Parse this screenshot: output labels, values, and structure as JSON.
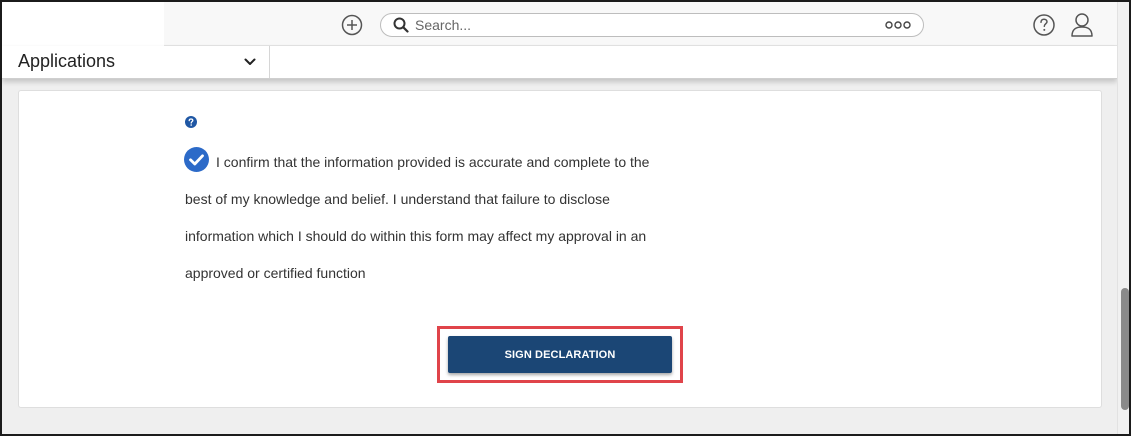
{
  "topbar": {
    "search_placeholder": "Search...",
    "add_icon": "plus-circle-icon",
    "search_icon": "magnifier-icon",
    "more_icon": "ellipsis-icon",
    "help_icon": "question-circle-icon",
    "user_icon": "user-profile-icon"
  },
  "appbar": {
    "app_label": "Applications",
    "dropdown_icon": "chevron-down-icon"
  },
  "form": {
    "help_icon": "question-circle-icon",
    "checkbox_checked": true,
    "declaration_text": "I confirm that the information provided is accurate and complete to the best of my knowledge and belief. I understand that failure to disclose information which I should do within this form may affect my approval in an approved or certified function",
    "sign_button_label": "SIGN DECLARATION"
  },
  "colors": {
    "primary": "#1b4675",
    "check_blue": "#2c6ac8",
    "highlight_red": "#e0444a"
  }
}
